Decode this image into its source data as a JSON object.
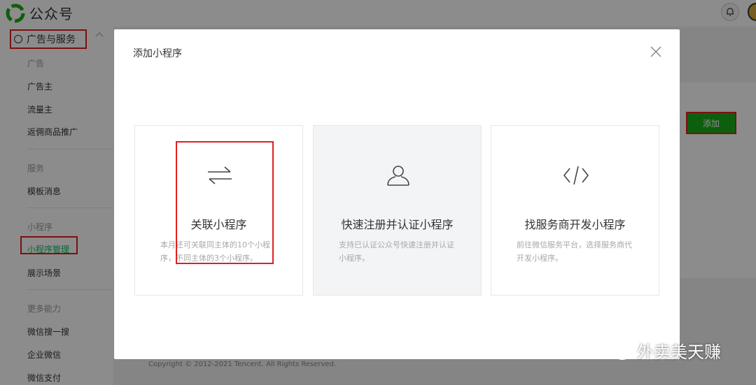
{
  "app": {
    "title": "公众号"
  },
  "sidebar": {
    "section_title": "广告与服务",
    "groups": [
      {
        "label": "广告",
        "items": [
          "广告主",
          "流量主",
          "返佣商品推广"
        ]
      },
      {
        "label": "服务",
        "items": [
          "模板消息"
        ]
      },
      {
        "label": "小程序",
        "items": [
          "小程序管理",
          "展示场景"
        ]
      },
      {
        "label": "更多能力",
        "items": [
          "微信搜一搜",
          "企业微信",
          "微信支付"
        ]
      }
    ],
    "active_item": "小程序管理"
  },
  "background": {
    "add_button": "添加",
    "copyright": "Copyright © 2012-2021 Tencent. All Rights Reserved."
  },
  "modal": {
    "title": "添加小程序",
    "cards": [
      {
        "title": "关联小程序",
        "desc": "本月还可关联同主体的10个小程序，不同主体的3个小程序。",
        "icon": "swap-arrows-icon"
      },
      {
        "title": "快速注册并认证小程序",
        "desc": "支持已认证公众号快速注册并认证小程序。",
        "icon": "user-icon"
      },
      {
        "title": "找服务商开发小程序",
        "desc": "前往微信服务平台，选择服务商代开发小程序。",
        "icon": "code-icon"
      }
    ]
  },
  "watermark": {
    "text": "外卖美天赚"
  },
  "colors": {
    "accent": "#07c160",
    "highlight": "#e02020",
    "button": "#1aad19"
  }
}
